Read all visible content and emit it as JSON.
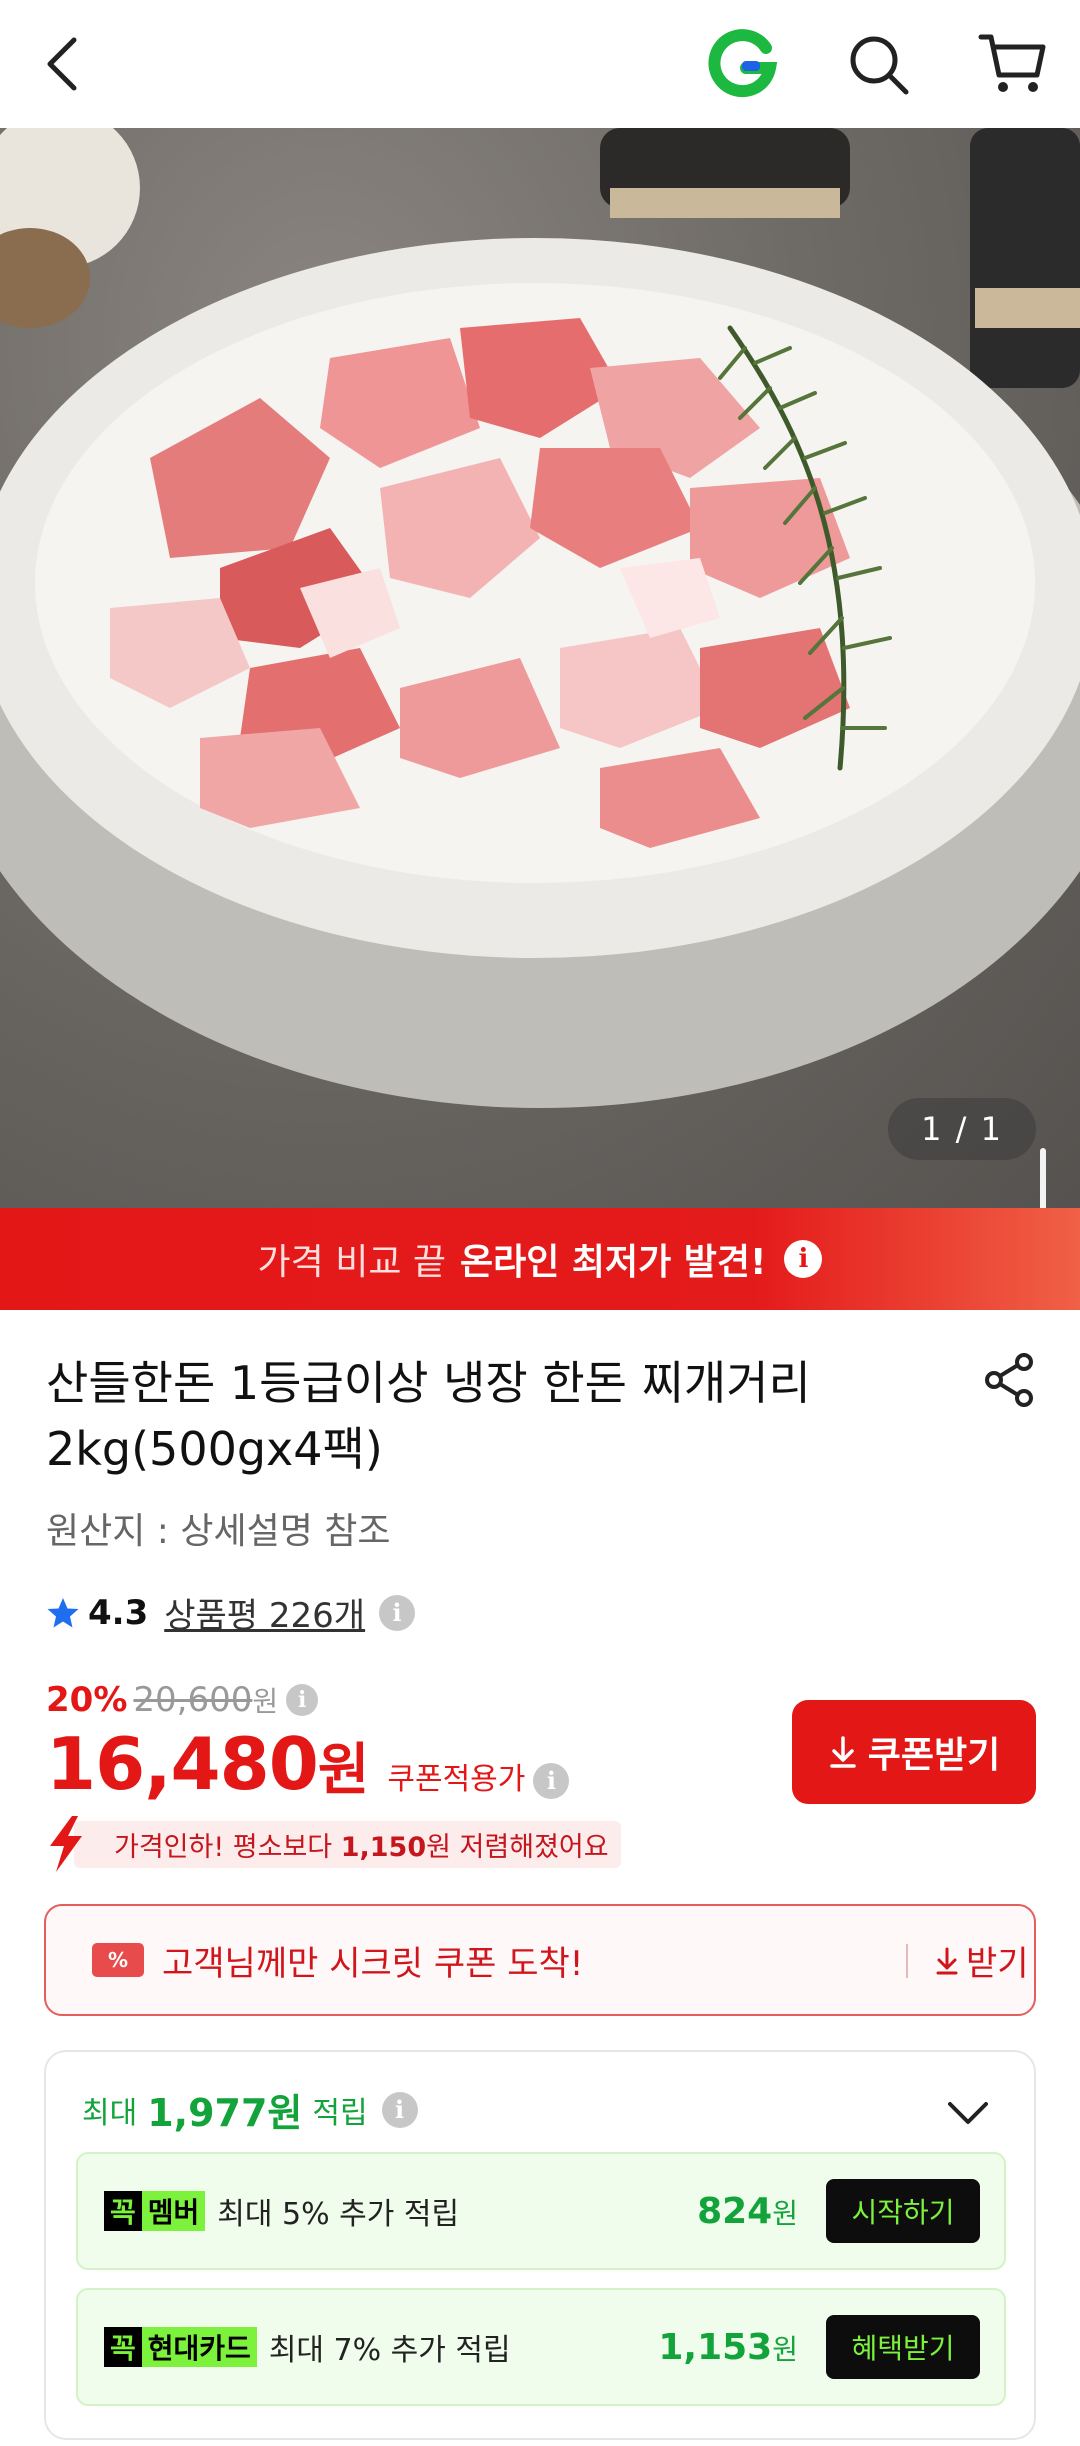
{
  "header": {
    "icons": [
      "back-icon",
      "gmarket-g-logo",
      "search-icon",
      "cart-icon"
    ]
  },
  "gallery": {
    "counter": "1 / 1"
  },
  "banner": {
    "prefix": "가격 비교 끝",
    "highlight": "온라인 최저가 발견!",
    "info": "i"
  },
  "product": {
    "title": "산들한돈 1등급이상 냉장 한돈 찌개거리 2kg(500gx4팩)",
    "origin": "원산지 : 상세설명 참조",
    "rating": "4.3",
    "reviews": "상품평 226개"
  },
  "price": {
    "discount_rate": "20%",
    "original_price": "20,600",
    "original_unit": "원",
    "sale_price": "16,480",
    "sale_unit": "원",
    "coupon_applied_label": "쿠폰적용가",
    "coupon_button": "쿠폰받기",
    "drop_text_before": "가격인하! 평소보다 ",
    "drop_amount": "1,150",
    "drop_text_after": "원 저렴해졌어요"
  },
  "secret_coupon": {
    "tag": "%",
    "message": "고객님께만 시크릿 쿠폰 도착!",
    "receive": "받기"
  },
  "reward": {
    "prefix": "최대",
    "amount": "1,977원",
    "suffix": "적립",
    "offers": [
      {
        "brand_k": "꼭",
        "brand_name": "멤버",
        "desc": "최대 5% 추가 적립",
        "points": "824",
        "unit": "원",
        "action": "시작하기"
      },
      {
        "brand_k": "꼭",
        "brand_name": "현대카드",
        "desc": "최대 7% 추가 적립",
        "points": "1,153",
        "unit": "원",
        "action": "혜택받기"
      }
    ]
  },
  "colors": {
    "brand_red": "#e41717",
    "brand_green": "#13a33b",
    "neon_green": "#7cf23d"
  }
}
